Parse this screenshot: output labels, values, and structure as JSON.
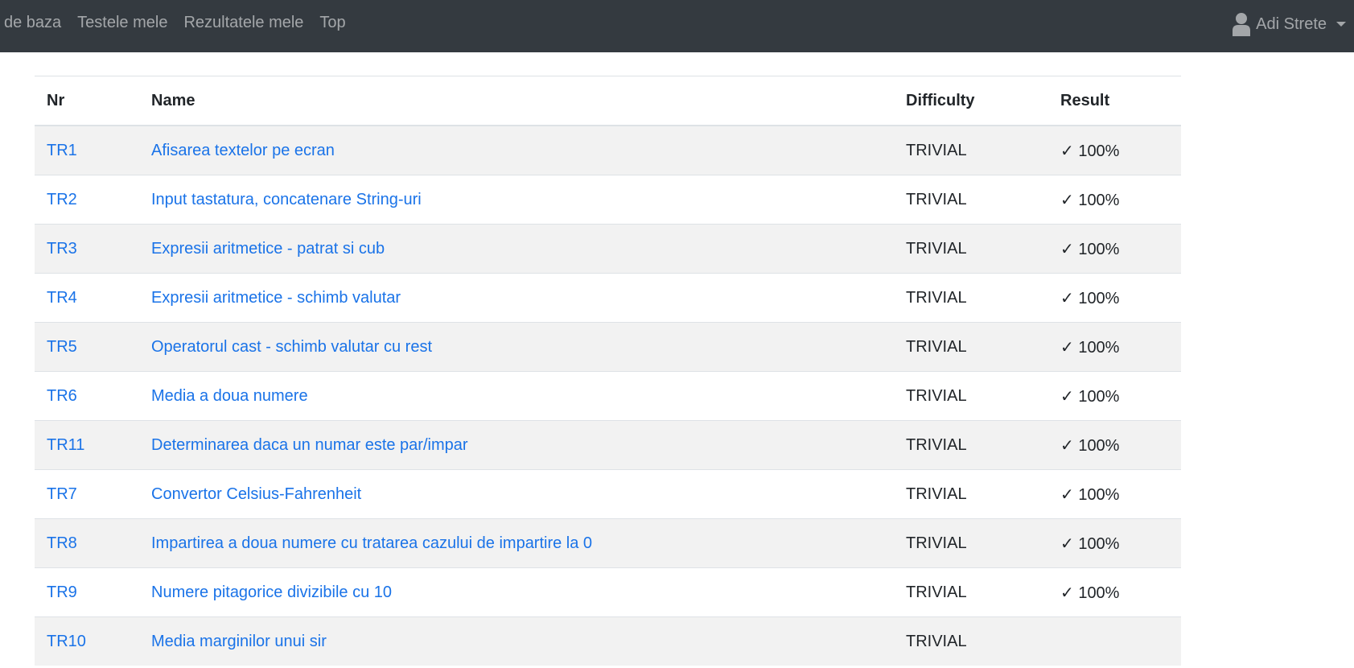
{
  "nav": {
    "links": [
      "i de baza",
      "Testele mele",
      "Rezultatele mele",
      "Top"
    ],
    "user_name": "Adi Strete"
  },
  "table": {
    "headers": {
      "nr": "Nr",
      "name": "Name",
      "difficulty": "Difficulty",
      "result": "Result"
    },
    "rows": [
      {
        "nr": "TR1",
        "name": "Afisarea textelor pe ecran",
        "difficulty": "TRIVIAL",
        "result": "✓ 100%"
      },
      {
        "nr": "TR2",
        "name": "Input tastatura, concatenare String-uri",
        "difficulty": "TRIVIAL",
        "result": "✓ 100%"
      },
      {
        "nr": "TR3",
        "name": "Expresii aritmetice - patrat si cub",
        "difficulty": "TRIVIAL",
        "result": "✓ 100%"
      },
      {
        "nr": "TR4",
        "name": "Expresii aritmetice - schimb valutar",
        "difficulty": "TRIVIAL",
        "result": "✓ 100%"
      },
      {
        "nr": "TR5",
        "name": "Operatorul cast - schimb valutar cu rest",
        "difficulty": "TRIVIAL",
        "result": "✓ 100%"
      },
      {
        "nr": "TR6",
        "name": "Media a doua numere",
        "difficulty": "TRIVIAL",
        "result": "✓ 100%"
      },
      {
        "nr": "TR11",
        "name": "Determinarea daca un numar este par/impar",
        "difficulty": "TRIVIAL",
        "result": "✓ 100%"
      },
      {
        "nr": "TR7",
        "name": "Convertor Celsius-Fahrenheit",
        "difficulty": "TRIVIAL",
        "result": "✓ 100%"
      },
      {
        "nr": "TR8",
        "name": "Impartirea a doua numere cu tratarea cazului de impartire la 0",
        "difficulty": "TRIVIAL",
        "result": "✓ 100%"
      },
      {
        "nr": "TR9",
        "name": "Numere pitagorice divizibile cu 10",
        "difficulty": "TRIVIAL",
        "result": "✓ 100%"
      },
      {
        "nr": "TR10",
        "name": "Media marginilor unui sir",
        "difficulty": "TRIVIAL",
        "result": ""
      }
    ]
  },
  "colors": {
    "navbar_bg": "#343a40",
    "link": "#1a73e8",
    "striped_row": "#f2f2f2"
  }
}
